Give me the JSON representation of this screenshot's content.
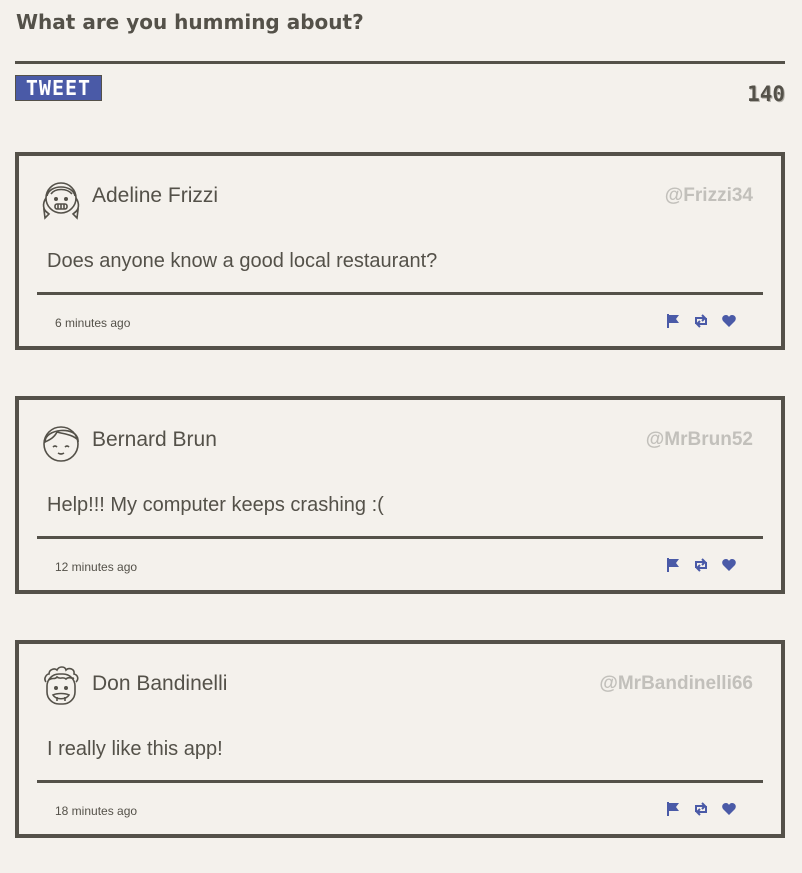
{
  "compose": {
    "label": "What are you humming about?",
    "tweet_button": "TWEET",
    "char_count": "140"
  },
  "colors": {
    "accent": "#4a5aa7",
    "text": "#545149",
    "muted": "#c2c0bb",
    "background": "#f4f1ec"
  },
  "tweets": [
    {
      "name": "Adeline Frizzi",
      "handle": "@Frizzi34",
      "text": "Does anyone know a good local restaurant?",
      "time": "6 minutes ago",
      "avatar_icon": "girl-avatar-icon"
    },
    {
      "name": "Bernard Brun",
      "handle": "@MrBrun52",
      "text": "Help!!! My computer keeps crashing :(",
      "time": "12 minutes ago",
      "avatar_icon": "boy-avatar-icon"
    },
    {
      "name": "Don Bandinelli",
      "handle": "@MrBandinelli66",
      "text": "I really like this app!",
      "time": "18 minutes ago",
      "avatar_icon": "curly-hair-avatar-icon"
    }
  ],
  "actions": [
    "flag-icon",
    "retweet-icon",
    "heart-icon"
  ]
}
